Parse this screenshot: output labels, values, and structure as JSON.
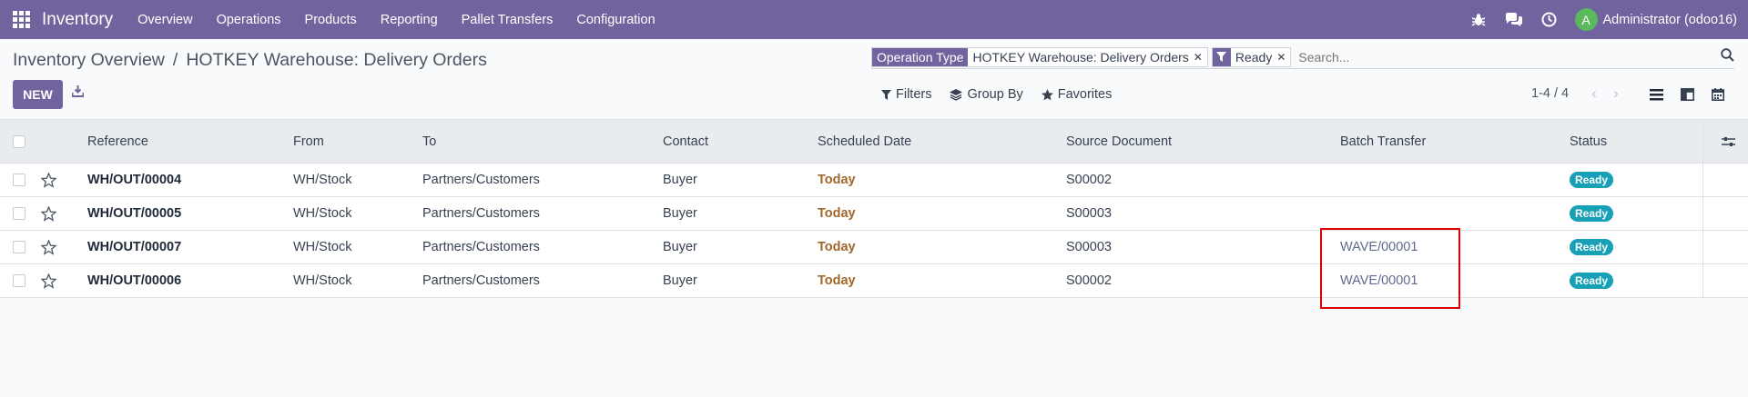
{
  "navbar": {
    "brand": "Inventory",
    "menu": [
      "Overview",
      "Operations",
      "Products",
      "Reporting",
      "Pallet Transfers",
      "Configuration"
    ],
    "user": {
      "initial": "A",
      "name": "Administrator (odoo16)"
    },
    "system_icons": [
      "bug-icon",
      "chat-icon",
      "clock-icon"
    ]
  },
  "breadcrumb": {
    "parent": "Inventory Overview",
    "separator": "/",
    "current": "HOTKEY Warehouse: Delivery Orders"
  },
  "search": {
    "facets": [
      {
        "label": "Operation Type",
        "value": "HOTKEY Warehouse: Delivery Orders"
      },
      {
        "label": "filter-icon",
        "value": "Ready"
      }
    ],
    "placeholder": "Search..."
  },
  "toolbar": {
    "new_label": "NEW",
    "filters_label": "Filters",
    "group_by_label": "Group By",
    "favorites_label": "Favorites"
  },
  "pager": {
    "text": "1-4 / 4",
    "prev": "‹",
    "next": "›"
  },
  "table": {
    "columns": [
      "Reference",
      "From",
      "To",
      "Contact",
      "Scheduled Date",
      "Source Document",
      "Batch Transfer",
      "Status"
    ],
    "rows": [
      {
        "reference": "WH/OUT/00004",
        "from": "WH/Stock",
        "to": "Partners/Customers",
        "contact": "Buyer",
        "scheduled": "Today",
        "source": "S00002",
        "batch": "",
        "status": "Ready"
      },
      {
        "reference": "WH/OUT/00005",
        "from": "WH/Stock",
        "to": "Partners/Customers",
        "contact": "Buyer",
        "scheduled": "Today",
        "source": "S00003",
        "batch": "",
        "status": "Ready"
      },
      {
        "reference": "WH/OUT/00007",
        "from": "WH/Stock",
        "to": "Partners/Customers",
        "contact": "Buyer",
        "scheduled": "Today",
        "source": "S00003",
        "batch": "WAVE/00001",
        "status": "Ready"
      },
      {
        "reference": "WH/OUT/00006",
        "from": "WH/Stock",
        "to": "Partners/Customers",
        "contact": "Buyer",
        "scheduled": "Today",
        "source": "S00002",
        "batch": "WAVE/00001",
        "status": "Ready"
      }
    ]
  },
  "colors": {
    "brand": "#71639e",
    "status_ready": "#18a0b6",
    "today": "#a0662a",
    "highlight": "#e00000"
  }
}
